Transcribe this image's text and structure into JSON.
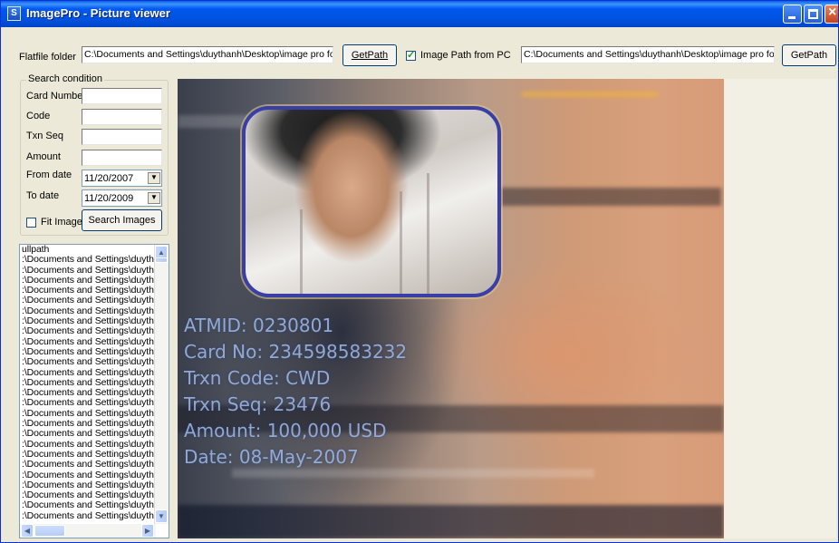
{
  "window": {
    "title": "ImagePro - Picture viewer",
    "app_icon": "S"
  },
  "toolbar": {
    "flatfile_label": "Flatfile folder",
    "flatfile_path": "C:\\Documents and Settings\\duythanh\\Desktop\\image pro for",
    "getpath_label": "GetPath",
    "image_path_checkbox_label": "Image Path from PC",
    "image_path_checked": true,
    "image_path_value": "C:\\Documents and Settings\\duythanh\\Desktop\\image pro for",
    "getpath2_label": "GetPath"
  },
  "search": {
    "group_title": "Search condition",
    "card_number_label": "Card Number",
    "code_label": "Code",
    "txn_seq_label": "Txn Seq",
    "amount_label": "Amount",
    "from_date_label": "From date",
    "from_date_value": "11/20/2007",
    "to_date_label": "To date",
    "to_date_value": "11/20/2009",
    "fit_image_label": "Fit Image",
    "fit_image_checked": false,
    "search_button_label": "Search Images"
  },
  "file_list": {
    "header": "ullpath",
    "items": [
      ":\\Documents and Settings\\duyth",
      ":\\Documents and Settings\\duyth",
      ":\\Documents and Settings\\duyth",
      ":\\Documents and Settings\\duyth",
      ":\\Documents and Settings\\duyth",
      ":\\Documents and Settings\\duyth",
      ":\\Documents and Settings\\duyth",
      ":\\Documents and Settings\\duyth",
      ":\\Documents and Settings\\duyth",
      ":\\Documents and Settings\\duyth",
      ":\\Documents and Settings\\duyth",
      ":\\Documents and Settings\\duyth",
      ":\\Documents and Settings\\duyth",
      ":\\Documents and Settings\\duyth",
      ":\\Documents and Settings\\duyth",
      ":\\Documents and Settings\\duyth",
      ":\\Documents and Settings\\duyth",
      ":\\Documents and Settings\\duyth",
      ":\\Documents and Settings\\duyth",
      ":\\Documents and Settings\\duyth",
      ":\\Documents and Settings\\duyth",
      ":\\Documents and Settings\\duyth",
      ":\\Documents and Settings\\duyth",
      ":\\Documents and Settings\\duyth",
      ":\\Documents and Settings\\duyth",
      ":\\Documents and Settings\\duyth"
    ]
  },
  "image_overlay": {
    "atmid": "ATMID: 0230801",
    "card_no": "Card No: 234598583232",
    "trxn_code": "Trxn Code: CWD",
    "trxn_seq": "Trxn Seq: 23476",
    "amount": "Amount: 100,000 USD",
    "date": "Date: 08-May-2007"
  }
}
